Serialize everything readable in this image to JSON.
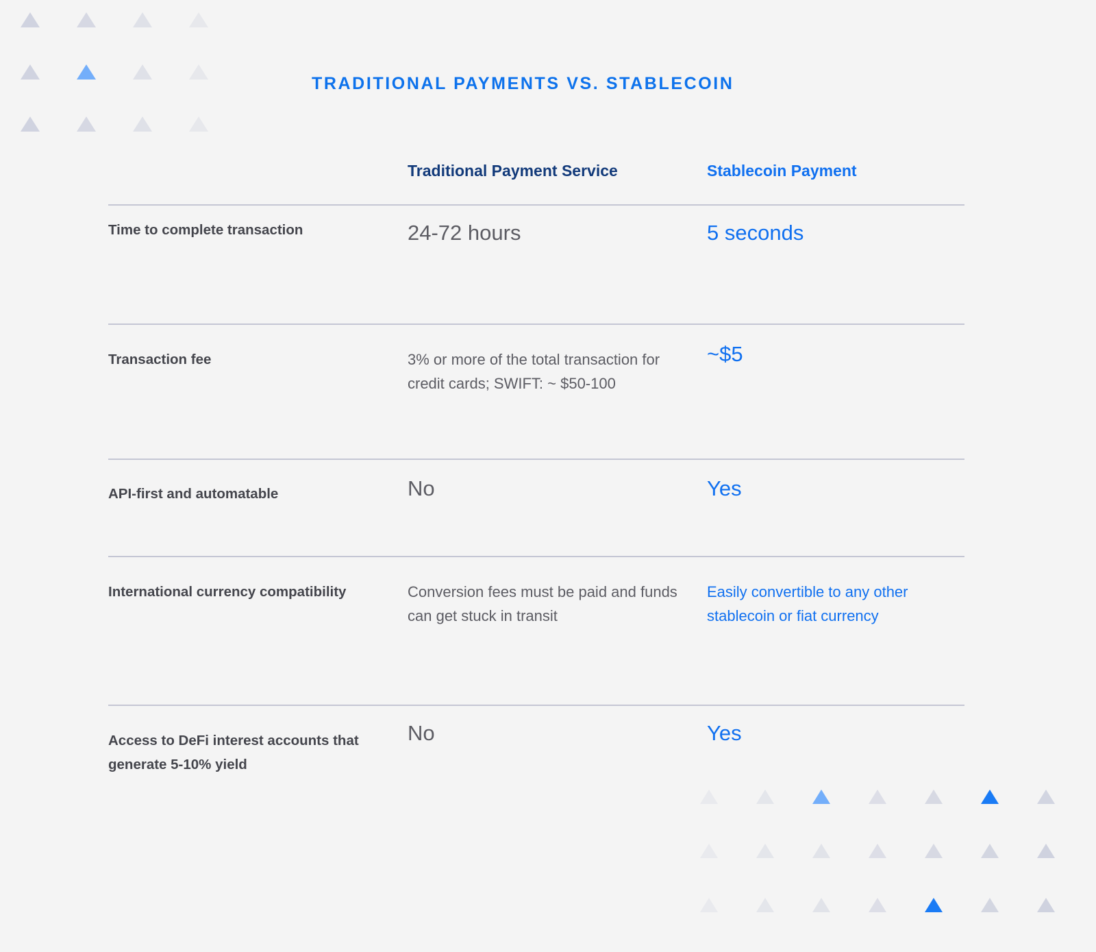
{
  "title": "TRADITIONAL PAYMENTS VS. STABLECOIN",
  "colors": {
    "background": "#f4f4f4",
    "title_blue": "#0d72ec",
    "header_navy": "#123a7a",
    "accent_blue": "#1070f0",
    "label_gray": "#44454c",
    "value_gray": "#5c5c63",
    "divider": "#c4c6d4",
    "triangle_base": "#ced1de",
    "triangle_highlight_light": "#73aefa",
    "triangle_highlight_strong": "#1a7bf5"
  },
  "table": {
    "columns": [
      {
        "key": "label",
        "header": ""
      },
      {
        "key": "traditional",
        "header": "Traditional Payment Service"
      },
      {
        "key": "stablecoin",
        "header": "Stablecoin Payment"
      }
    ],
    "rows": [
      {
        "label": "Time to complete transaction",
        "traditional": "24-72 hours",
        "stablecoin": "5 seconds",
        "size": "big"
      },
      {
        "label": "Transaction fee",
        "traditional": "3% or more of the total transaction for credit cards; SWIFT: ~ $50-100",
        "stablecoin": "~$5",
        "size": "mixed"
      },
      {
        "label": "API-first and automatable",
        "traditional": "No",
        "stablecoin": "Yes",
        "size": "big"
      },
      {
        "label": "International currency compatibility",
        "traditional": "Conversion fees must be paid and funds can get stuck in transit",
        "stablecoin": "Easily convertible to any other stablecoin or fiat currency",
        "size": "med"
      },
      {
        "label": "Access to DeFi interest accounts that generate 5-10% yield",
        "traditional": "No",
        "stablecoin": "Yes",
        "size": "big"
      }
    ]
  },
  "decor": {
    "top_left_grid": {
      "cols": 4,
      "rows": 3,
      "highlight": [
        {
          "row": 1,
          "col": 1,
          "color": "#73aefa"
        }
      ],
      "opacities": [
        [
          0.95,
          0.8,
          0.55,
          0.35
        ],
        [
          0.95,
          1.0,
          0.55,
          0.35
        ],
        [
          0.95,
          0.8,
          0.55,
          0.35
        ]
      ]
    },
    "bottom_right_grid": {
      "cols": 7,
      "rows": 3,
      "highlight": [
        {
          "row": 0,
          "col": 2,
          "color": "#73aefa"
        },
        {
          "row": 0,
          "col": 5,
          "color": "#1a7bf5"
        },
        {
          "row": 2,
          "col": 4,
          "color": "#1a7bf5"
        }
      ],
      "opacities": [
        [
          0.28,
          0.42,
          1.0,
          0.62,
          0.78,
          1.0,
          0.92
        ],
        [
          0.28,
          0.42,
          0.5,
          0.62,
          0.78,
          0.88,
          0.98
        ],
        [
          0.28,
          0.42,
          0.5,
          0.62,
          1.0,
          0.88,
          0.98
        ]
      ]
    }
  }
}
